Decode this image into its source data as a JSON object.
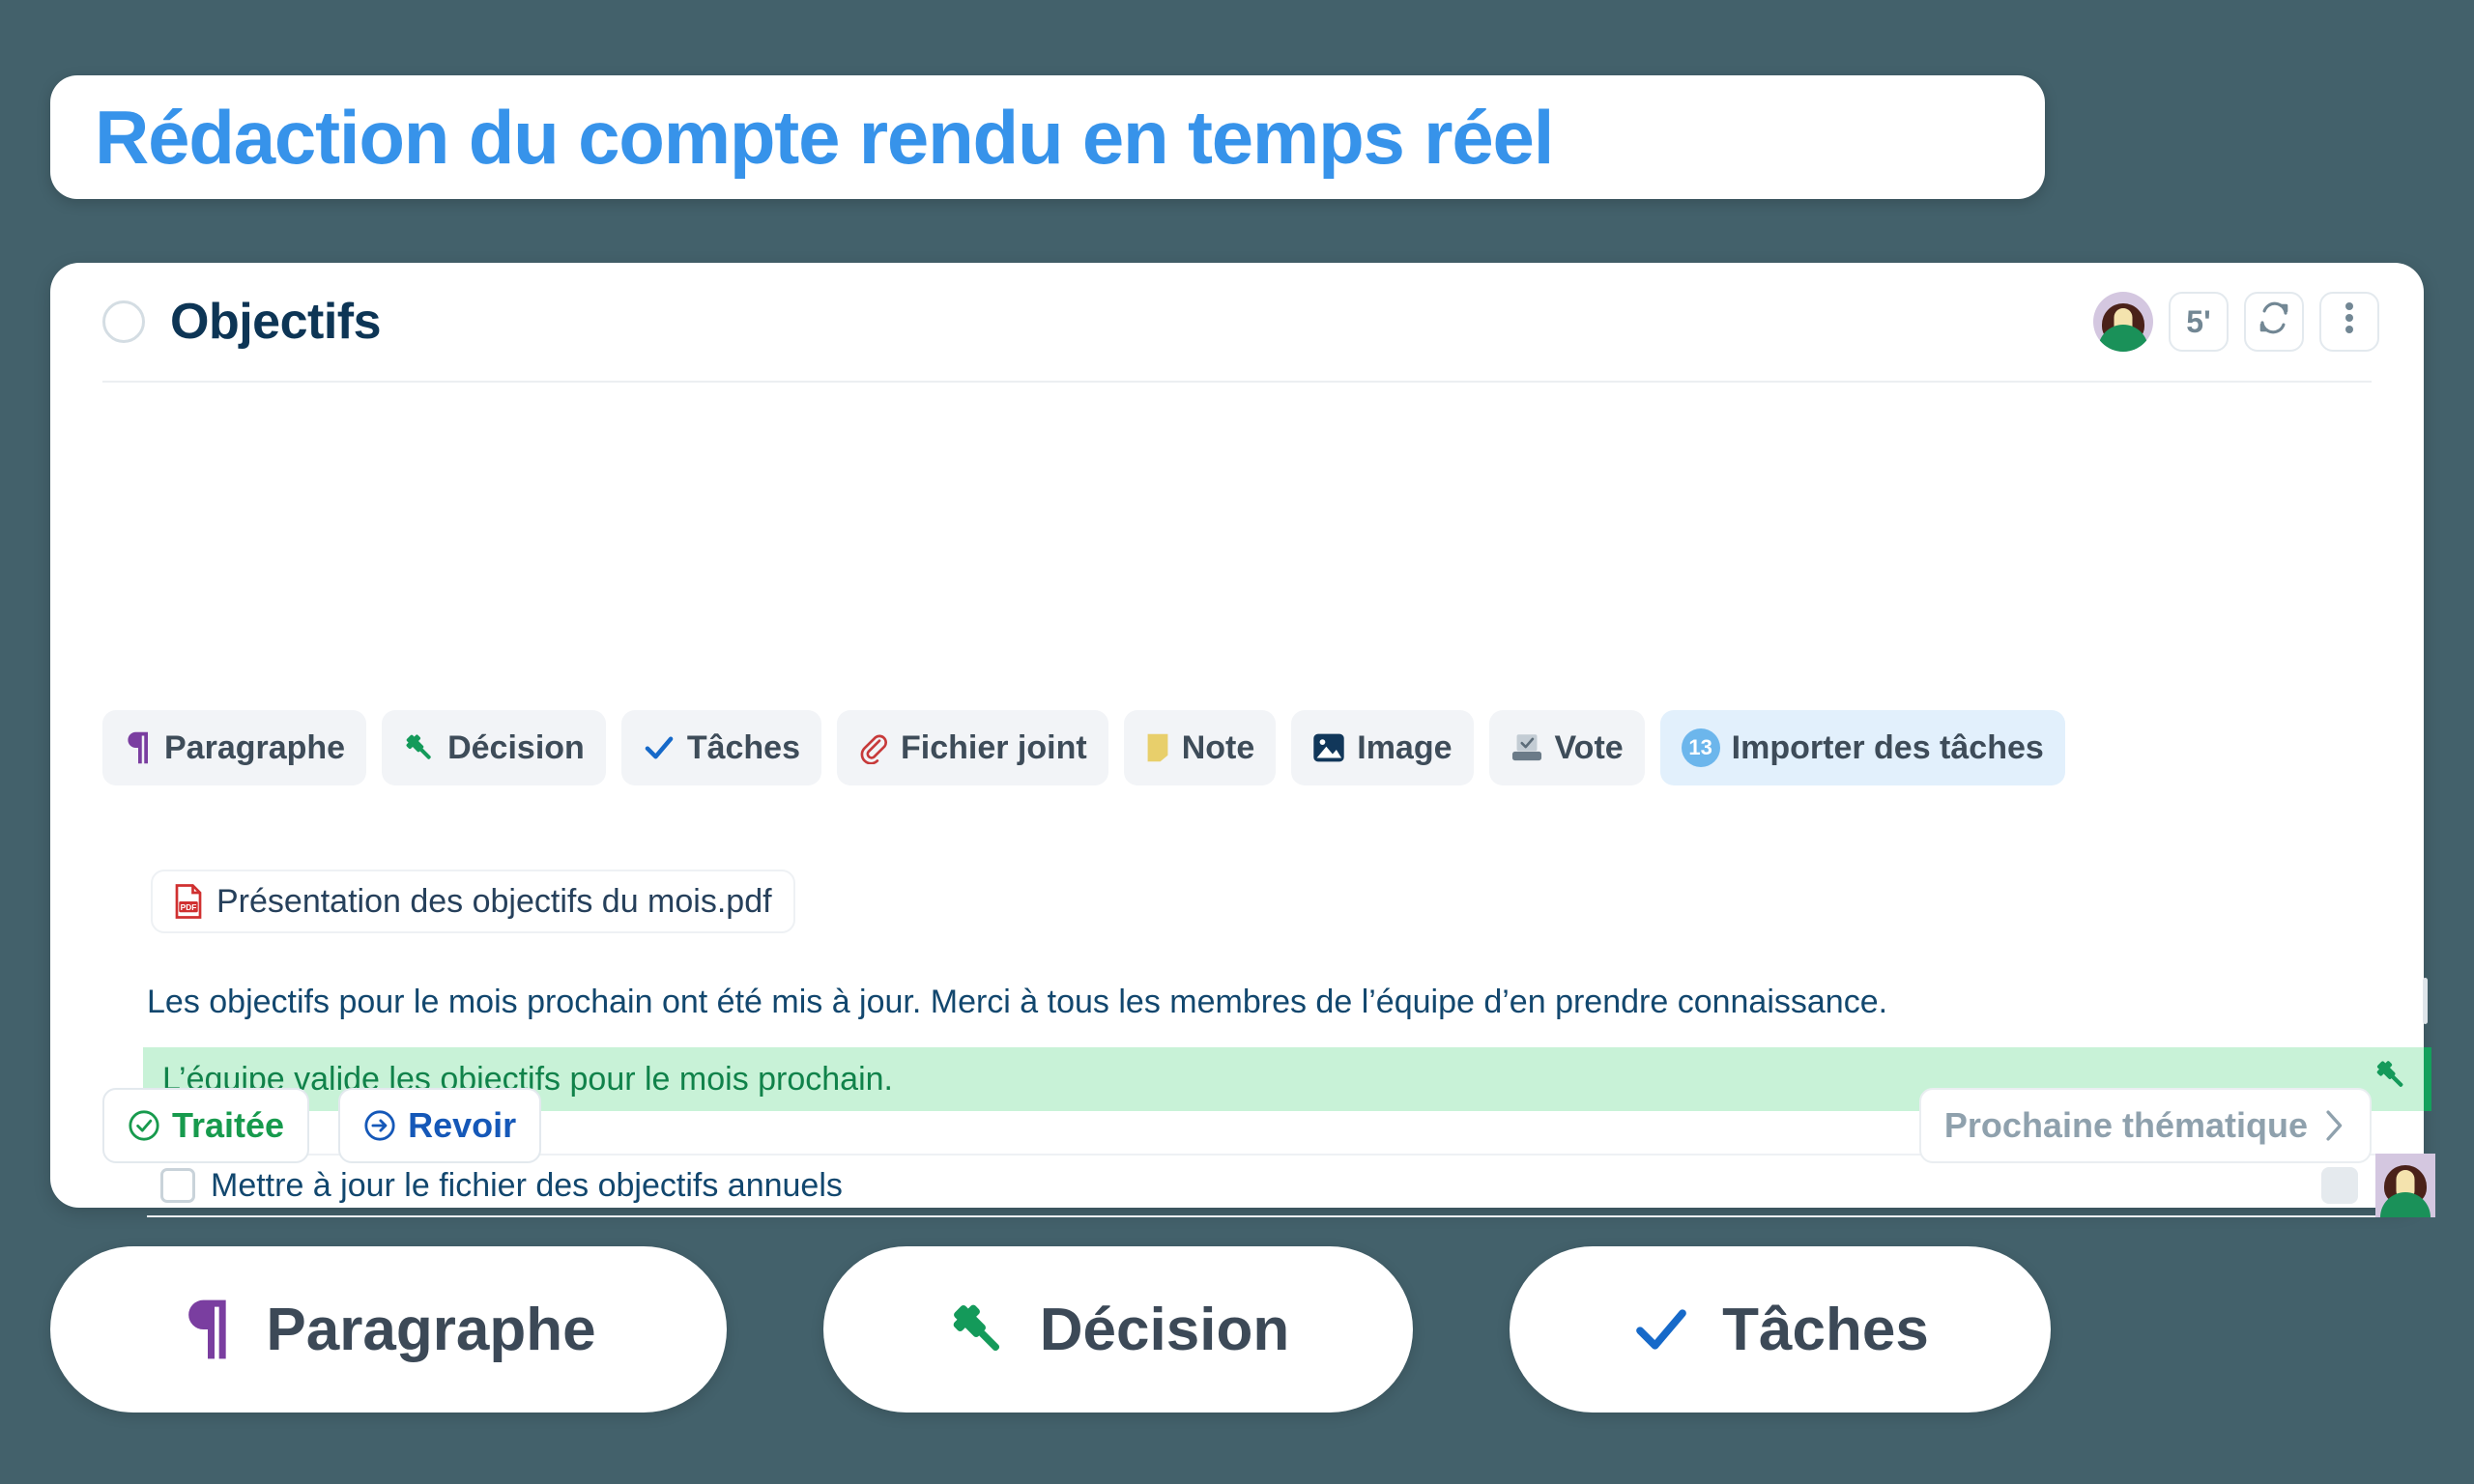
{
  "banner": {
    "title": "Rédaction du compte rendu en temps réel"
  },
  "card": {
    "section_title": "Objectifs",
    "header_actions": {
      "timer_label": "5'",
      "refresh_icon": "refresh-icon",
      "more_icon": "more-vertical-icon",
      "avatar_icon": "user-avatar"
    },
    "chips": [
      {
        "label": "Paragraphe",
        "icon": "pilcrow-icon",
        "color": "#7a3ea0"
      },
      {
        "label": "Décision",
        "icon": "gavel-icon",
        "color": "#149a5a"
      },
      {
        "label": "Tâches",
        "icon": "check-icon",
        "color": "#1669c9"
      },
      {
        "label": "Fichier joint",
        "icon": "paperclip-icon",
        "color": "#c73a3a"
      },
      {
        "label": "Note",
        "icon": "sticky-note-icon",
        "color": "#e8cf6b"
      },
      {
        "label": "Image",
        "icon": "image-icon",
        "color": "#11375a"
      },
      {
        "label": "Vote",
        "icon": "ballot-box-icon",
        "color": "#6b7b88"
      },
      {
        "label": "Importer des tâches",
        "icon": "import-badge-icon",
        "color": "#6cb6ec",
        "badge": "13",
        "highlight": true
      }
    ],
    "attachment": {
      "filename": "Présentation des objectifs du mois.pdf",
      "icon": "pdf-file-icon"
    },
    "entries": {
      "paragraph": "Les objectifs pour le mois prochain ont été mis à jour. Merci à tous les membres de l’équipe d’en prendre connaissance.",
      "decision": "L’équipe valide les objectifs pour le mois prochain.",
      "task": "Mettre à jour le fichier des objectifs annuels"
    },
    "footer": {
      "traitee_label": "Traitée",
      "revoir_label": "Revoir",
      "next_label": "Prochaine thématique",
      "next_icon": "chevron-right-icon"
    }
  },
  "bottom_pills": [
    {
      "label": "Paragraphe",
      "icon": "pilcrow-icon"
    },
    {
      "label": "Décision",
      "icon": "gavel-icon"
    },
    {
      "label": "Tâches",
      "icon": "check-icon"
    }
  ],
  "colors": {
    "background": "#43616b",
    "brand_blue": "#3793ea",
    "decision_green_bg": "#c8f2d7",
    "decision_green_text": "#10824a",
    "dark_navy": "#0d3555"
  }
}
